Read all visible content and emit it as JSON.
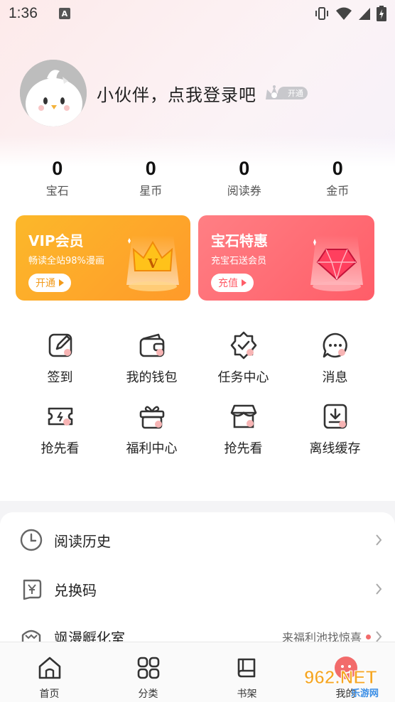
{
  "status_bar": {
    "time": "1:36",
    "badge": "A"
  },
  "profile": {
    "login_text": "小伙伴，点我登录吧",
    "vip_badge": "开通"
  },
  "stats": [
    {
      "value": "0",
      "label": "宝石"
    },
    {
      "value": "0",
      "label": "星币"
    },
    {
      "value": "0",
      "label": "阅读券"
    },
    {
      "value": "0",
      "label": "金币"
    }
  ],
  "promos": {
    "vip": {
      "title": "VIP会员",
      "subtitle": "畅读全站98%漫画",
      "button": "开通"
    },
    "gem": {
      "title": "宝石特惠",
      "subtitle": "充宝石送会员",
      "button": "充值"
    }
  },
  "grid": [
    {
      "label": "签到",
      "icon": "edit-icon"
    },
    {
      "label": "我的钱包",
      "icon": "wallet-icon"
    },
    {
      "label": "任务中心",
      "icon": "badge-check-icon"
    },
    {
      "label": "消息",
      "icon": "chat-bubble-icon"
    },
    {
      "label": "抢先看",
      "icon": "ticket-icon"
    },
    {
      "label": "福利中心",
      "icon": "gift-icon"
    },
    {
      "label": "抢先看",
      "icon": "store-icon"
    },
    {
      "label": "离线缓存",
      "icon": "download-icon"
    }
  ],
  "list": {
    "history": "阅读历史",
    "redeem": "兑换码",
    "incubator": "飒漫孵化室",
    "incubator_extra": "来福利池找惊喜"
  },
  "tabs": [
    {
      "label": "首页",
      "icon": "home-icon"
    },
    {
      "label": "分类",
      "icon": "grid-icon"
    },
    {
      "label": "书架",
      "icon": "book-icon"
    },
    {
      "label": "我的",
      "icon": "profile-icon"
    }
  ],
  "watermark": {
    "text": "962.NET",
    "sub": "乐游网"
  },
  "colors": {
    "vip_orange": "#ff9a2a",
    "gem_red": "#ff5d68",
    "accent_dot": "#f26b6b"
  }
}
